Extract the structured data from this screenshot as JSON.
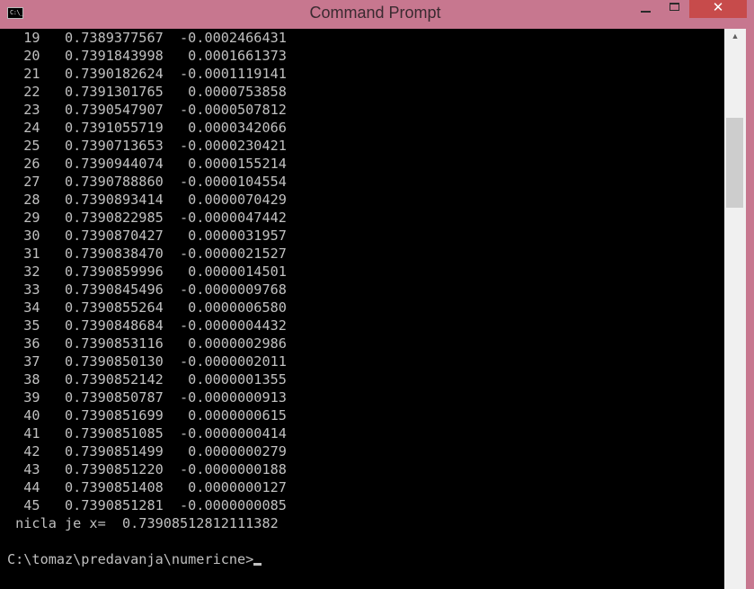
{
  "window": {
    "title": "Command Prompt",
    "icon_glyph": "C:\\_",
    "minimize_glyph": "",
    "maximize_glyph": "",
    "close_glyph": "✕",
    "colors": {
      "frame": "#c7778f",
      "close_button": "#c74b4b",
      "console_bg": "#000000",
      "console_fg": "#c0c0c0"
    }
  },
  "console": {
    "lines": [
      "  19   0.7389377567  -0.0002466431",
      "  20   0.7391843998   0.0001661373",
      "  21   0.7390182624  -0.0001119141",
      "  22   0.7391301765   0.0000753858",
      "  23   0.7390547907  -0.0000507812",
      "  24   0.7391055719   0.0000342066",
      "  25   0.7390713653  -0.0000230421",
      "  26   0.7390944074   0.0000155214",
      "  27   0.7390788860  -0.0000104554",
      "  28   0.7390893414   0.0000070429",
      "  29   0.7390822985  -0.0000047442",
      "  30   0.7390870427   0.0000031957",
      "  31   0.7390838470  -0.0000021527",
      "  32   0.7390859996   0.0000014501",
      "  33   0.7390845496  -0.0000009768",
      "  34   0.7390855264   0.0000006580",
      "  35   0.7390848684  -0.0000004432",
      "  36   0.7390853116   0.0000002986",
      "  37   0.7390850130  -0.0000002011",
      "  38   0.7390852142   0.0000001355",
      "  39   0.7390850787  -0.0000000913",
      "  40   0.7390851699   0.0000000615",
      "  41   0.7390851085  -0.0000000414",
      "  42   0.7390851499   0.0000000279",
      "  43   0.7390851220  -0.0000000188",
      "  44   0.7390851408   0.0000000127",
      "  45   0.7390851281  -0.0000000085",
      " nicla je x=  0.73908512812111382",
      ""
    ],
    "prompt": "C:\\tomaz\\predavanja\\numericne>"
  },
  "scrollbar": {
    "up_arrow": "▲",
    "position_fraction": 0.14
  }
}
